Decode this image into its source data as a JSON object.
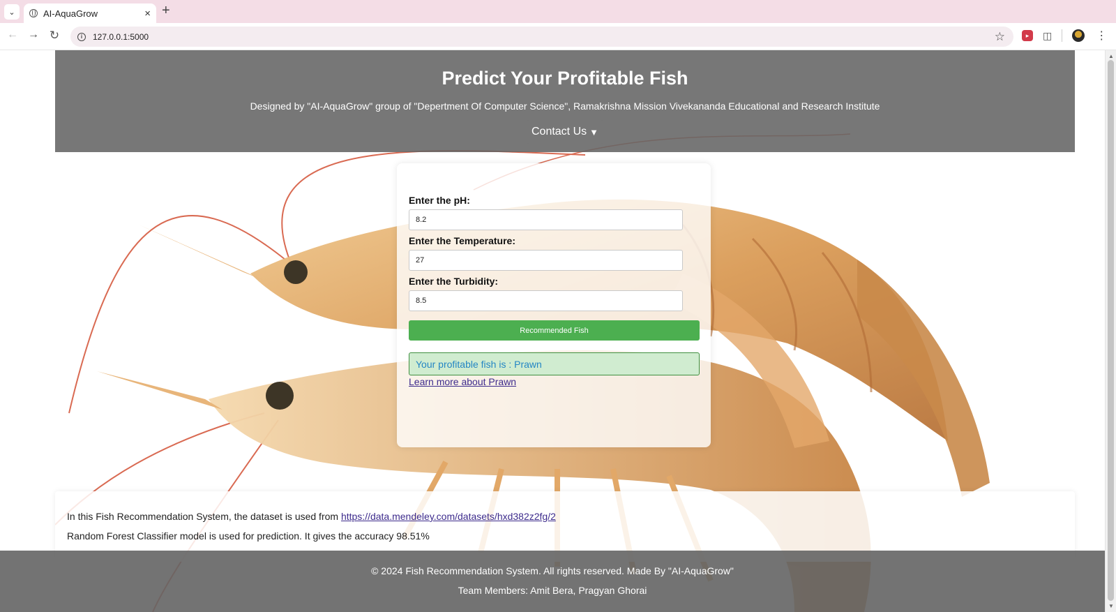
{
  "browser": {
    "tab_title": "AI-AquaGrow",
    "new_tab": "+",
    "close_tab": "×",
    "url": "127.0.0.1:5000"
  },
  "header": {
    "title": "Predict Your Profitable Fish",
    "subtitle": "Designed by \"AI-AquaGrow\" group of \"Depertment Of Computer Science\", Ramakrishna Mission Vivekananda Educational and Research Institute",
    "contact_label": "Contact Us",
    "contact_caret": "▼"
  },
  "form": {
    "ph_label": "Enter the pH:",
    "ph_value": "8.2",
    "temperature_label": "Enter the Temperature:",
    "temperature_value": "27",
    "turbidity_label": "Enter the Turbidity:",
    "turbidity_value": "8.5",
    "submit_label": "Recommended Fish",
    "result_text": "Your profitable fish is : Prawn",
    "learn_more_text": "Learn more about Prawn"
  },
  "info": {
    "dataset_prefix": "In this Fish Recommendation System, the dataset is used from ",
    "dataset_link": "https://data.mendeley.com/datasets/hxd382z2fg/2",
    "model_text": "Random Forest Classifier model is used for prediction. It gives the accuracy 98.51%"
  },
  "footer": {
    "copyright": "© 2024 Fish Recommendation System. All rights reserved. Made By \"AI-AquaGrow\"",
    "team": "Team Members: Amit Bera, Pragyan Ghorai"
  },
  "colors": {
    "tab_strip": "#f4dde6",
    "header_overlay": "#646464",
    "button_green": "#4caf50",
    "result_bg": "#d0ecd0",
    "result_text": "#2486c4",
    "link": "#3d2b8c"
  },
  "icons": {
    "tab_menu": "chevron-down-icon",
    "favicon": "globe-icon",
    "back": "arrow-left-icon",
    "forward": "arrow-right-icon",
    "reload": "reload-icon",
    "site_info": "info-icon",
    "bookmark": "star-icon",
    "extension": "puzzle-icon",
    "menu": "more-vertical-icon"
  }
}
